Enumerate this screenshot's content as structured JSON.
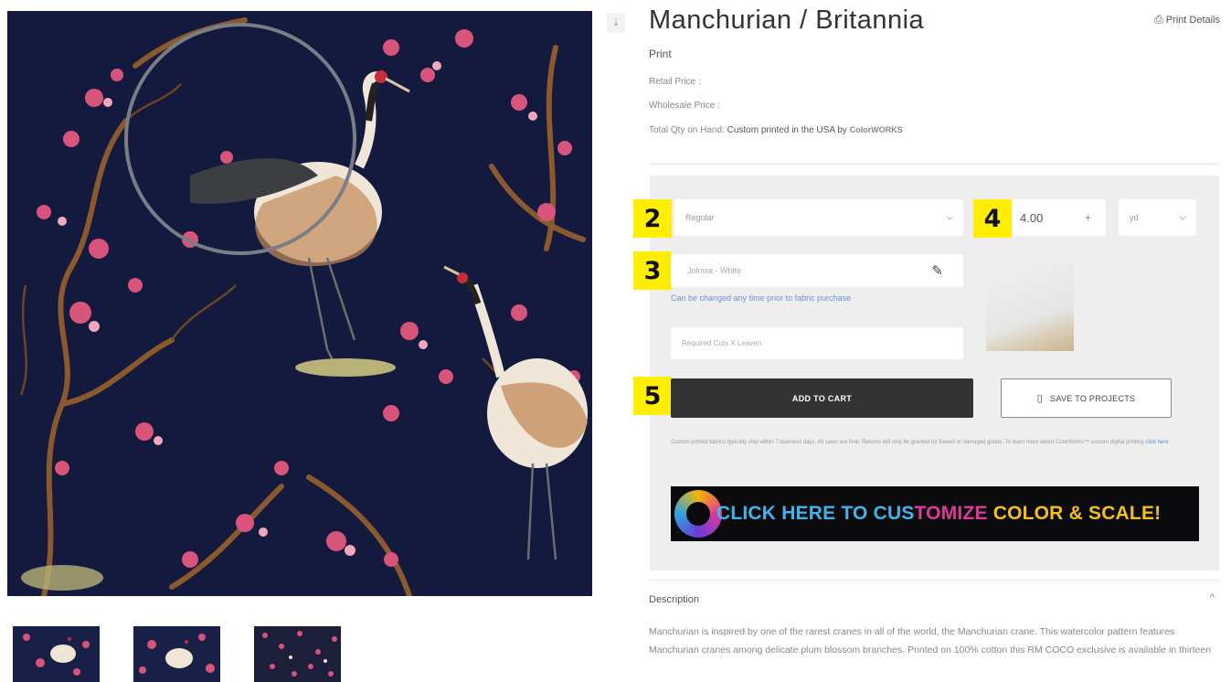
{
  "product": {
    "title": "Manchurian / Britannia",
    "subtitle": "Print",
    "retail_price_label": "Retail Price :",
    "wholesale_price_label": "Wholesale Price :",
    "qty_label": "Total Qty on Hand:",
    "qty_value": "Custom printed in the USA by",
    "logo_text": "ColorWORKS"
  },
  "header": {
    "print_details_label": "Print Details",
    "download_icon": "download-icon"
  },
  "config": {
    "scale_select_value": "Regular",
    "quantity_value": "4.00",
    "quantity_plus": "+",
    "unit_select_value": "yd",
    "ground_color_value": "Jolnwa - White",
    "change_note": "Can be changed any time prior to fabric purchase",
    "cuts_placeholder": "Required Cuts X Leaven",
    "add_to_cart_label": "ADD TO CART",
    "save_to_projects_label": "SAVE TO PROJECTS",
    "ship_note": "Custom printed fabrics typically ship within 7 business days. All sales are final. Returns will only be granted for flawed or damaged goods. To learn more about ColorWorks™ custom digital printing",
    "ship_note_link": "click here",
    "banner_parts": [
      {
        "text": "CLICK HERE TO CUS",
        "color": "#3fb5ec"
      },
      {
        "text": "TOMIZE",
        "color": "#e0389b"
      },
      {
        "text": " COLOR & SCALE!",
        "color": "#f2c21a"
      }
    ]
  },
  "badges": [
    "2",
    "3",
    "4",
    "5"
  ],
  "description": {
    "header": "Description",
    "toggle": "^",
    "body": "Manchurian is inspired by one of the rarest cranes in all of the world, the Manchurian crane. This watercolor pattern features Manchurian cranes among delicate plum blossom branches. Printed on 100% cotton this RM COCO exclusive is available in thirteen"
  },
  "thumbnails": [
    "thumbnail-1",
    "thumbnail-2",
    "thumbnail-3"
  ],
  "colors": {
    "navy_background": "#131a3d",
    "panel_gray": "#eeeeee",
    "button_dark": "#333333",
    "badge_yellow": "#ffee00",
    "link_blue": "#6f8fd6"
  }
}
